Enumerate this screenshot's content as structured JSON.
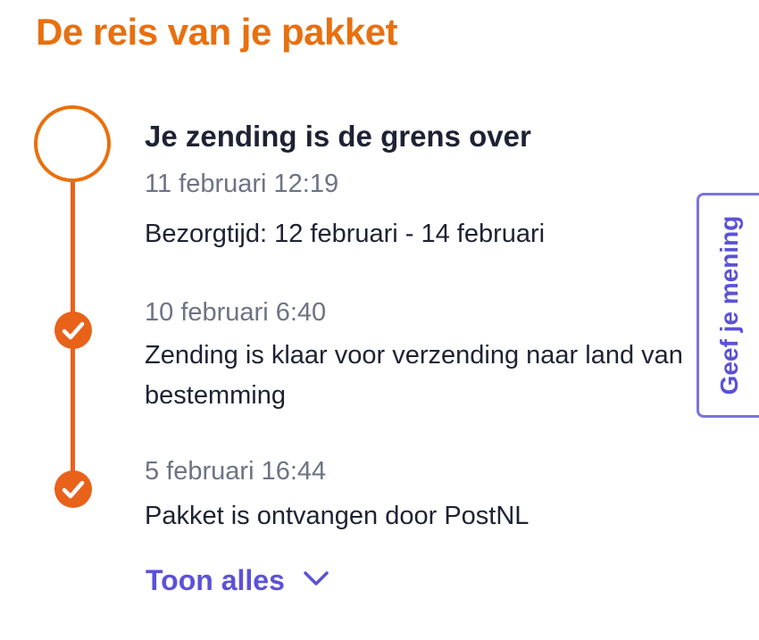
{
  "page": {
    "title": "De reis van je pakket"
  },
  "colors": {
    "accent_orange": "#e8700f",
    "timeline_orange": "#e8621a",
    "link_purple": "#5b52d6",
    "text_dark": "#1e2233",
    "text_muted": "#6d7385"
  },
  "timeline": {
    "events": [
      {
        "state": "current",
        "title": "Je zending is de grens over",
        "time": "11 februari 12:19",
        "description": "Bezorgtijd: 12 februari - 14 februari"
      },
      {
        "state": "done",
        "time": "10 februari 6:40",
        "description": "Zending is klaar voor verzending naar land van bestemming"
      },
      {
        "state": "done",
        "time": "5 februari 16:44",
        "description": "Pakket is ontvangen door PostNL"
      }
    ]
  },
  "show_all": {
    "label": "Toon alles",
    "icon": "chevron-down-icon"
  },
  "feedback": {
    "label": "Geef je mening"
  }
}
